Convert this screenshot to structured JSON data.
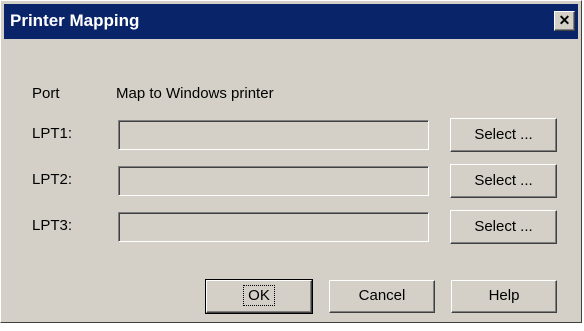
{
  "window": {
    "title": "Printer Mapping",
    "close_glyph": "✕"
  },
  "headers": {
    "port": "Port",
    "map_to": "Map to Windows printer"
  },
  "ports": [
    {
      "label": "LPT1:",
      "value": "",
      "select_label": "Select ..."
    },
    {
      "label": "LPT2:",
      "value": "",
      "select_label": "Select ..."
    },
    {
      "label": "LPT3:",
      "value": "",
      "select_label": "Select ..."
    }
  ],
  "buttons": {
    "ok": "OK",
    "cancel": "Cancel",
    "help": "Help"
  },
  "colors": {
    "title_bar": "#0a246a",
    "face": "#d4d0c8"
  }
}
